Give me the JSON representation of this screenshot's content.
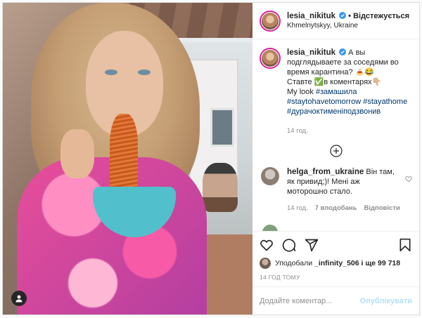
{
  "post": {
    "username": "lesia_nikituk",
    "follow_label": "Відстежується",
    "location": "Khmelnytskyy, Ukraine",
    "caption": {
      "line1": "А вы подглядываете за соседями во время карантина?",
      "emoji1": "🍝😂",
      "line2": "Ставте ✅в коментарях👇🏼",
      "line3": "My look",
      "hashtag1": "#замашила",
      "hashtags2": "#staytohavetomorrow #stayathome",
      "hashtag3": "#дурачоктименіподзвонив"
    },
    "caption_time": "14 год.",
    "comment": {
      "username": "helga_from_ukraine",
      "text": "Він там, як привид;)! Мені аж моторошно стало.",
      "time": "14 год.",
      "likes": "7 вподобань",
      "reply": "Відповісти"
    },
    "likes": {
      "prefix": "Уподобали",
      "user": "_infinity_506",
      "suffix": "і ще 99 718"
    },
    "posted": "14 ГОД ТОМУ",
    "add_comment_placeholder": "Додайте коментар...",
    "publish_label": "Опублікувати"
  },
  "colors": {
    "link": "#00376b",
    "muted": "#8e8e8e",
    "publish_disabled": "#b2dffc",
    "verified": "#3897f0"
  },
  "icons": [
    "user-tag-icon",
    "verified-icon",
    "plus-circle-icon",
    "heart-icon",
    "comment-icon",
    "share-icon",
    "bookmark-icon"
  ]
}
